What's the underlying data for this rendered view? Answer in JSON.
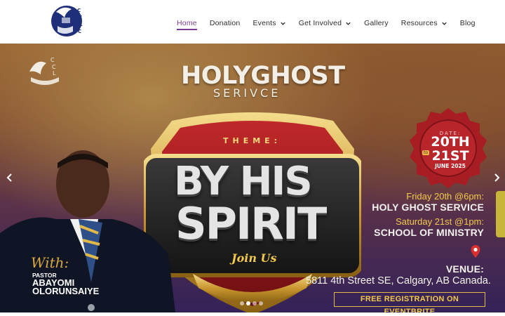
{
  "header": {
    "logo_letters": "CCLC",
    "nav": [
      {
        "label": "Home",
        "active": true,
        "dropdown": false
      },
      {
        "label": "Donation",
        "active": false,
        "dropdown": false
      },
      {
        "label": "Events",
        "active": false,
        "dropdown": true
      },
      {
        "label": "Get Involved",
        "active": false,
        "dropdown": true
      },
      {
        "label": "Gallery",
        "active": false,
        "dropdown": false
      },
      {
        "label": "Resources",
        "active": false,
        "dropdown": true
      },
      {
        "label": "Blog",
        "active": false,
        "dropdown": false
      }
    ]
  },
  "slide": {
    "title_line1": "HOLYGHOST",
    "title_line2": "SERIVCE",
    "theme_label": "THEME:",
    "theme_line1": "BY HIS",
    "theme_line2": "SPIRIT",
    "join": "Join Us",
    "date": {
      "label": "DATE:",
      "day1": "20TH",
      "to": "to",
      "day2": "21ST",
      "month": "JUNE 2025"
    },
    "events": [
      {
        "when": "Friday 20th @6pm:",
        "what": "HOLY GHOST SERVICE"
      },
      {
        "when": "Saturday 21st @1pm:",
        "what": "SCHOOL OF MINISTRY"
      }
    ],
    "venue_label": "VENUE:",
    "venue_address": "5811 4th Street SE, Calgary, AB Canada.",
    "registration": "FREE REGISTRATION ON EVENTBRITE",
    "with": "With:",
    "pastor_title": "PASTOR",
    "pastor_first": "ABAYOMI",
    "pastor_last": "OLORUNSAIYE"
  },
  "slider": {
    "slide_count": 4,
    "active_index": 1
  },
  "colors": {
    "accent": "#7a3b8f",
    "gold": "#f2c94c",
    "seal_red": "#a81d23"
  },
  "icons": {
    "prev": "chevron-left-icon",
    "next": "chevron-right-icon",
    "dropdown": "chevron-down-icon",
    "venue": "location-pin-icon"
  }
}
